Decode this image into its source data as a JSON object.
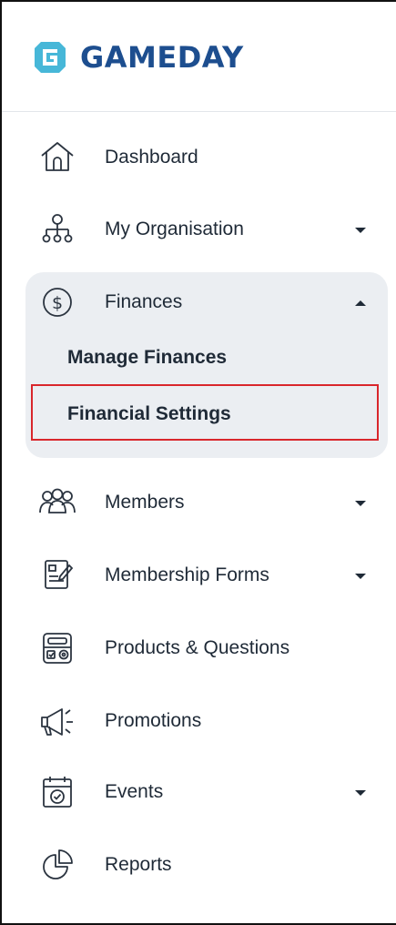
{
  "brand": {
    "name": "GAMEDAY",
    "color": "#1d4e8f"
  },
  "nav": {
    "dashboard": {
      "label": "Dashboard",
      "icon": "home-icon"
    },
    "organisation": {
      "label": "My Organisation",
      "icon": "org-chart-icon"
    },
    "finances": {
      "label": "Finances",
      "icon": "dollar-circle-icon",
      "expanded": true,
      "sub": {
        "manage": "Manage Finances",
        "settings": "Financial Settings"
      }
    },
    "members": {
      "label": "Members",
      "icon": "members-icon"
    },
    "membership_forms": {
      "label": "Membership Forms",
      "icon": "form-icon"
    },
    "products": {
      "label": "Products & Questions",
      "icon": "products-icon"
    },
    "promotions": {
      "label": "Promotions",
      "icon": "megaphone-icon"
    },
    "events": {
      "label": "Events",
      "icon": "calendar-icon"
    },
    "reports": {
      "label": "Reports",
      "icon": "pie-chart-icon"
    }
  },
  "colors": {
    "highlight": "#d9262c",
    "expanded_bg": "#ebeef2",
    "text": "#1f2a37",
    "icon": "#2b3440"
  }
}
